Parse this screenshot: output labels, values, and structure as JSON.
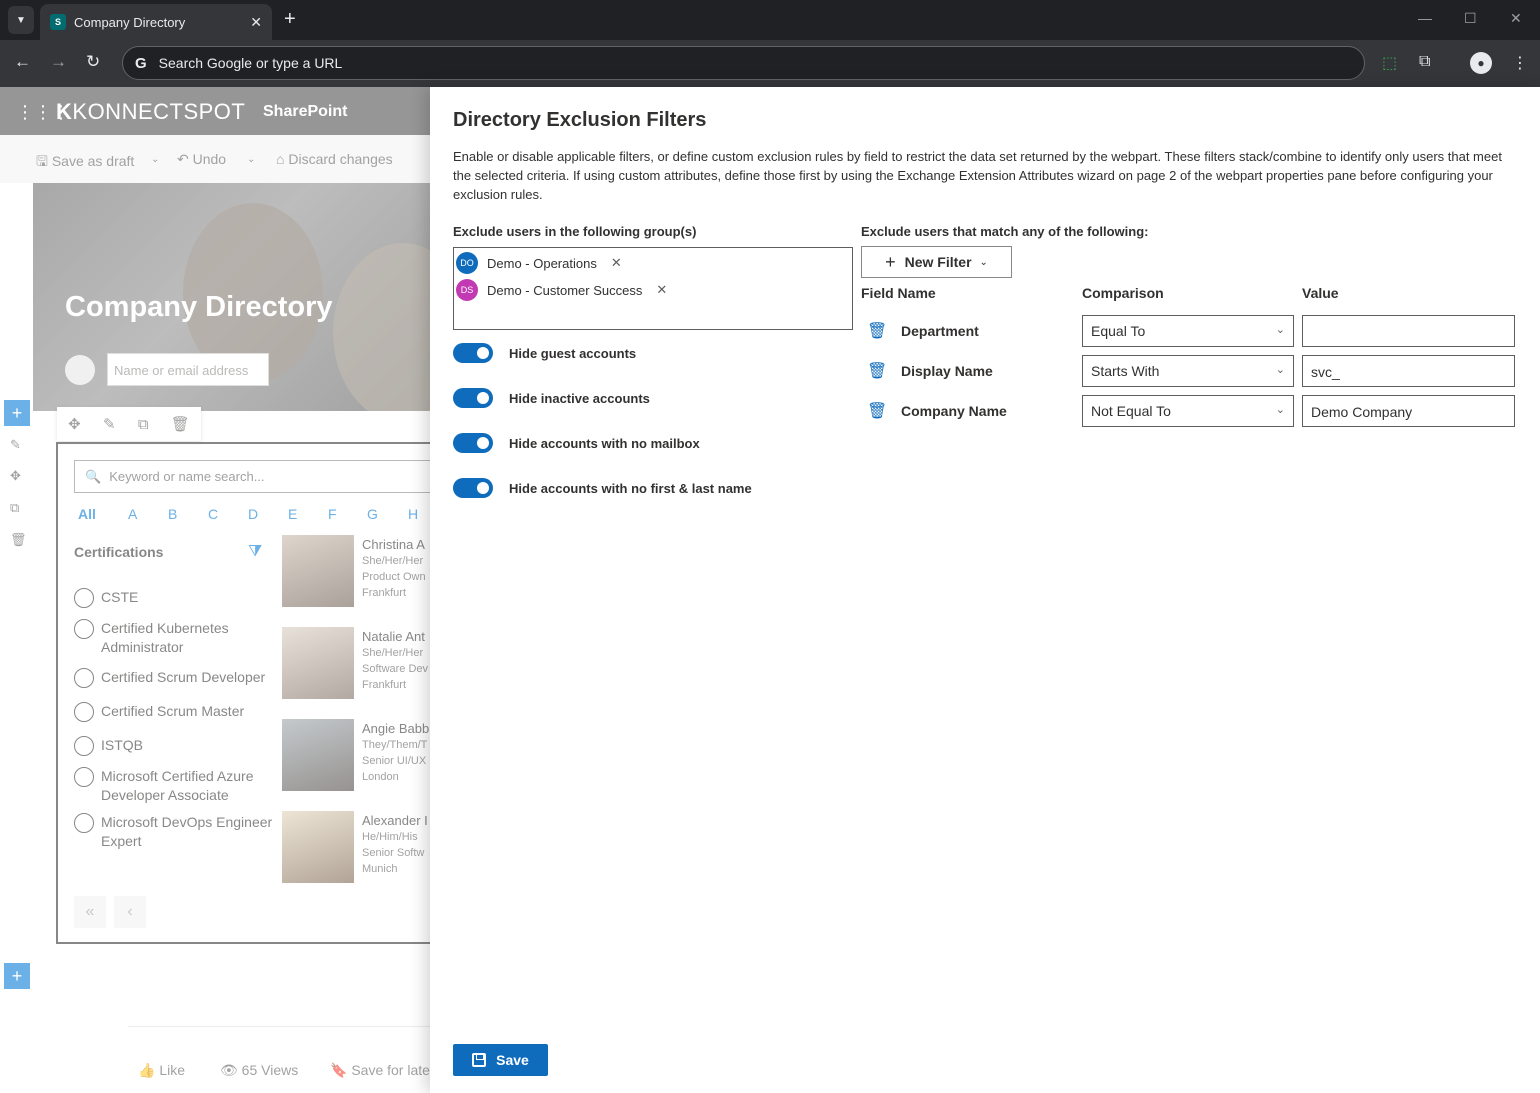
{
  "browser": {
    "tab_title": "Company Directory",
    "tab_favicon": "S",
    "omnibox_text": "Search Google or type a URL",
    "google_glyph": "G"
  },
  "sharepoint": {
    "brand": "KONNECTSPOT",
    "brand_k": "K",
    "app_name": "SharePoint",
    "cmd_save_draft": "Save as draft",
    "cmd_undo": "Undo",
    "cmd_discard": "Discard changes",
    "hero_title": "Company Directory",
    "hero_search_placeholder": "Name or email address",
    "keyword_placeholder": "Keyword or name search...",
    "alphabet": [
      "All",
      "A",
      "B",
      "C",
      "D",
      "E",
      "F",
      "G",
      "H"
    ],
    "cert_title": "Certifications",
    "certifications": [
      "CSTE",
      "Certified Kubernetes Administrator",
      "Certified Scrum Developer",
      "Certified Scrum Master",
      "ISTQB",
      "Microsoft Certified Azure Developer Associate",
      "Microsoft DevOps Engineer Expert"
    ],
    "people": [
      {
        "name": "Christina A",
        "pronouns": "She/Her/Her",
        "title": "Product Own",
        "city": "Frankfurt"
      },
      {
        "name": "Natalie Ant",
        "pronouns": "She/Her/Her",
        "title": "Software Dev",
        "city": "Frankfurt"
      },
      {
        "name": "Angie Babb",
        "pronouns": "They/Them/T",
        "title": "Senior UI/UX",
        "city": "London"
      },
      {
        "name": "Alexander I",
        "pronouns": "He/Him/His",
        "title": "Senior Softw",
        "city": "Munich"
      }
    ],
    "social_like": "Like",
    "social_views": "65 Views",
    "social_save": "Save for late"
  },
  "panel": {
    "title": "Directory Exclusion Filters",
    "description": "Enable or disable applicable filters, or define custom exclusion rules by field to restrict the data set returned by the webpart. These filters stack/combine to identify only users that meet the selected criteria. If using custom attributes, define those first by using the Exchange Extension Attributes wizard on page 2 of the webpart properties pane before configuring your exclusion rules.",
    "groups_label": "Exclude users in the following group(s)",
    "groups": [
      {
        "initials": "DO",
        "name": "Demo - Operations",
        "color": "#0f6cbd"
      },
      {
        "initials": "DS",
        "name": "Demo - Customer Success",
        "color": "#c239b3"
      }
    ],
    "toggles": [
      {
        "label": "Hide guest accounts",
        "on": true
      },
      {
        "label": "Hide inactive accounts",
        "on": true
      },
      {
        "label": "Hide accounts with no mailbox",
        "on": true
      },
      {
        "label": "Hide accounts with no first & last name",
        "on": true
      }
    ],
    "rules_label": "Exclude users that match any of the following:",
    "new_filter_label": "New Filter",
    "col_field": "Field Name",
    "col_comparison": "Comparison",
    "col_value": "Value",
    "rules": [
      {
        "field": "Department",
        "comparison": "Equal To",
        "value": ""
      },
      {
        "field": "Display Name",
        "comparison": "Starts With",
        "value": "svc_"
      },
      {
        "field": "Company Name",
        "comparison": "Not Equal To",
        "value": "Demo Company"
      }
    ],
    "save_label": "Save"
  },
  "colors": {
    "accent": "#0f6cbd",
    "chrome_dark": "#202124",
    "chrome_toolbar": "#35363a",
    "sp_header": "#4a4a4a"
  }
}
